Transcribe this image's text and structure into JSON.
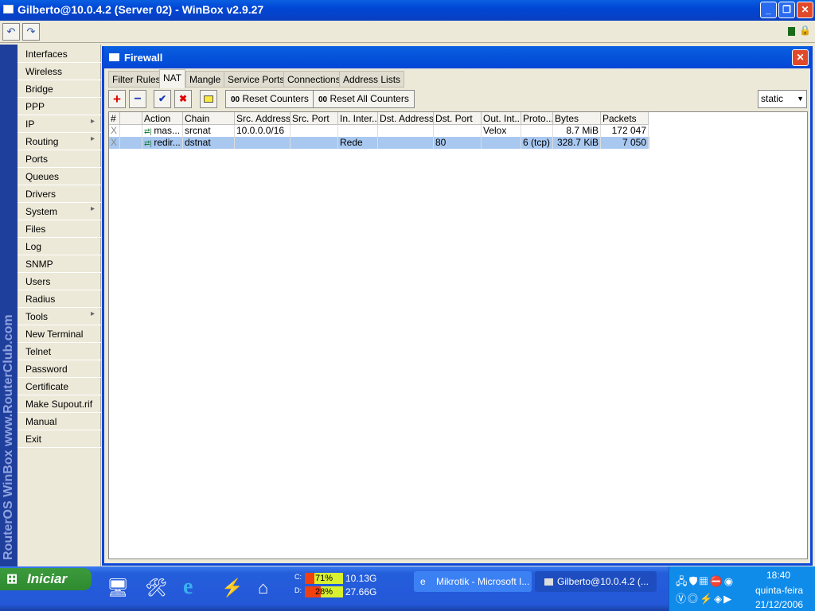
{
  "window": {
    "title": "Gilberto@10.0.4.2 (Server 02) - WinBox v2.9.27"
  },
  "toolbar": {
    "undo": "↶",
    "redo": "↷"
  },
  "sidebar": {
    "brand": "RouterOS WinBox  www.RouterClub.com",
    "items": [
      {
        "label": "Interfaces"
      },
      {
        "label": "Wireless"
      },
      {
        "label": "Bridge"
      },
      {
        "label": "PPP"
      },
      {
        "label": "IP",
        "sub": true
      },
      {
        "label": "Routing",
        "sub": true
      },
      {
        "label": "Ports"
      },
      {
        "label": "Queues"
      },
      {
        "label": "Drivers"
      },
      {
        "label": "System",
        "sub": true
      },
      {
        "label": "Files"
      },
      {
        "label": "Log"
      },
      {
        "label": "SNMP"
      },
      {
        "label": "Users"
      },
      {
        "label": "Radius"
      },
      {
        "label": "Tools",
        "sub": true
      },
      {
        "label": "New Terminal"
      },
      {
        "label": "Telnet"
      },
      {
        "label": "Password"
      },
      {
        "label": "Certificate"
      },
      {
        "label": "Make Supout.rif"
      },
      {
        "label": "Manual"
      },
      {
        "label": "Exit"
      }
    ]
  },
  "firewall": {
    "title": "Firewall",
    "tabs": [
      "Filter Rules",
      "NAT",
      "Mangle",
      "Service Ports",
      "Connections",
      "Address Lists"
    ],
    "active_tab": "NAT",
    "buttons": {
      "reset": "Reset Counters",
      "reset_all": "Reset All Counters",
      "counter_icon": "00"
    },
    "filter": "static",
    "columns": [
      "#",
      "",
      "Action",
      "Chain",
      "Src. Address",
      "Src. Port",
      "In. Inter...",
      "Dst. Address",
      "Dst. Port",
      "Out. Int...",
      "Proto...",
      "Bytes",
      "Packets"
    ],
    "rows": [
      {
        "num": "X",
        "action": "mas...",
        "chain": "srcnat",
        "src": "10.0.0.0/16",
        "sport": "",
        "inif": "",
        "dst": "",
        "dport": "",
        "outif": "Velox",
        "proto": "",
        "bytes": "8.7 MiB",
        "packets": "172 047"
      },
      {
        "num": "X",
        "action": "redir...",
        "chain": "dstnat",
        "src": "",
        "sport": "",
        "inif": "Rede",
        "dst": "",
        "dport": "80",
        "outif": "",
        "proto": "6 (tcp)",
        "bytes": "328.7 KiB",
        "packets": "7 050",
        "selected": true
      }
    ]
  },
  "taskbar": {
    "start": "Iniciar",
    "drives": [
      {
        "letter": "C:",
        "pct": "71%",
        "free": "10.13G",
        "fill": 71
      },
      {
        "letter": "D:",
        "pct": "28%",
        "free": "27.66G",
        "fill": 28
      }
    ],
    "tasks": [
      "Mikrotik - Microsoft I...",
      "Gilberto@10.0.4.2 (..."
    ],
    "time": "18:40",
    "day": "quinta-feira",
    "date": "21/12/2006"
  }
}
